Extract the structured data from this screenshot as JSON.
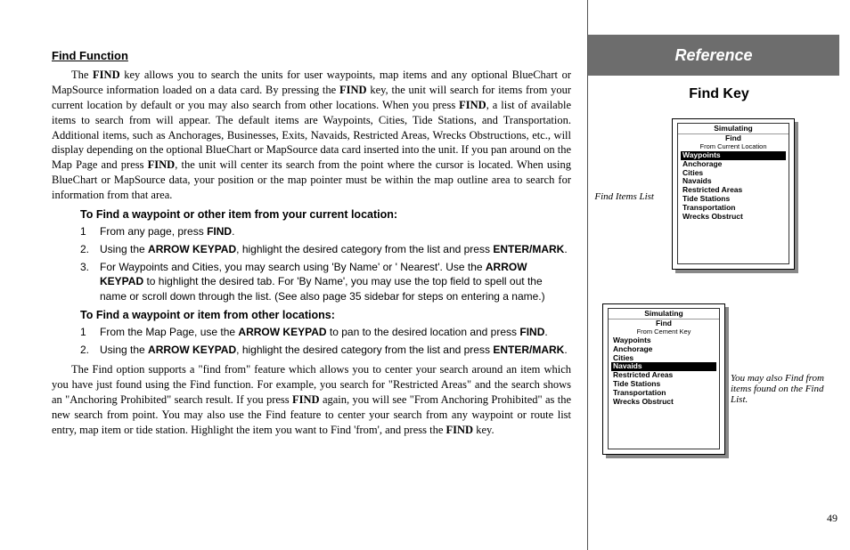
{
  "left": {
    "title": "Find Function",
    "para1_a": "The ",
    "para1_b": " key allows you to search the units for user waypoints, map items and any optional BlueChart or MapSource information loaded on a data card. By pressing the ",
    "para1_c": " key, the unit will search for items from your current location by default or you may also search from other locations. When you press ",
    "para1_d": ", a list of available items to search from will appear. The default items are Waypoints, Cities, Tide Stations, and Transportation. Additional items, such as Anchorages, Businesses, Exits, Navaids, Restricted Areas, Wrecks Obstructions, etc., will display depending on the optional BlueChart or MapSource data card inserted into the unit. If you pan around on the Map Page and press ",
    "para1_e": ", the unit will center its search from the point where the cursor is located. When using BlueChart or MapSource data, your position or the map pointer must be within the map outline area to search for information from that area.",
    "find_bold": "FIND",
    "sub1": "To Find a waypoint or other item from your current location:",
    "steps1": [
      {
        "n": "1",
        "a": "From any page, press ",
        "b": "FIND",
        "c": "."
      },
      {
        "n": "2.",
        "a": "Using the ",
        "b": "ARROW KEYPAD",
        "c": ", highlight the desired category from the list and press ",
        "d": "ENTER/MARK",
        "e": "."
      },
      {
        "n": "3.",
        "a": "For Waypoints and Cities, you may search using 'By Name' or ' Nearest'. Use the ",
        "b": "ARROW KEYPAD",
        "c": " to highlight the desired tab. For 'By Name', you may use the top field to spell out the name or scroll down through the list. (See also page 35 sidebar for steps on entering a name.)"
      }
    ],
    "sub2": "To Find a waypoint or item from other locations:",
    "steps2": [
      {
        "n": "1",
        "a": "From the Map Page, use the ",
        "b": "ARROW KEYPAD",
        "c": " to pan to the desired location and press ",
        "d": "FIND",
        "e": "."
      },
      {
        "n": "2.",
        "a": "Using the ",
        "b": "ARROW KEYPAD",
        "c": ", highlight the desired category from the list and press ",
        "d": "ENTER/MARK",
        "e": "."
      }
    ],
    "para2_a": "The Find option supports a \"find from\" feature which allows you to center your search around an item which you have just found using the Find function. For example, you search for \"Restricted Areas\" and the search shows an \"Anchoring Prohibited\" search result. If you press ",
    "para2_b": " again, you will see \"From Anchoring Prohibited\" as the new search from point. You may also use the Find feature to center your search from any waypoint or route list entry, map item or tide station. Highlight the item you want to Find 'from', and press the ",
    "para2_c": " key."
  },
  "right": {
    "banner": "Reference",
    "subtitle": "Find Key",
    "caption1": "Find Items List",
    "caption2": "You may also Find from items found on the Find List.",
    "shot1": {
      "sim": "Simulating",
      "title": "Find",
      "sub": "From Current Location",
      "highlight": "Waypoints",
      "items": [
        "Anchorage",
        "Cities",
        "Navaids",
        "Restricted Areas",
        "Tide Stations",
        "Transportation",
        "Wrecks Obstruct"
      ]
    },
    "shot2": {
      "sim": "Simulating",
      "title": "Find",
      "sub": "From Cement Key",
      "pre": [
        "Waypoints",
        "Anchorage",
        "Cities"
      ],
      "highlight": "Navaids",
      "post": [
        "Restricted Areas",
        "Tide Stations",
        "Transportation",
        "Wrecks Obstruct"
      ]
    },
    "page_num": "49"
  }
}
